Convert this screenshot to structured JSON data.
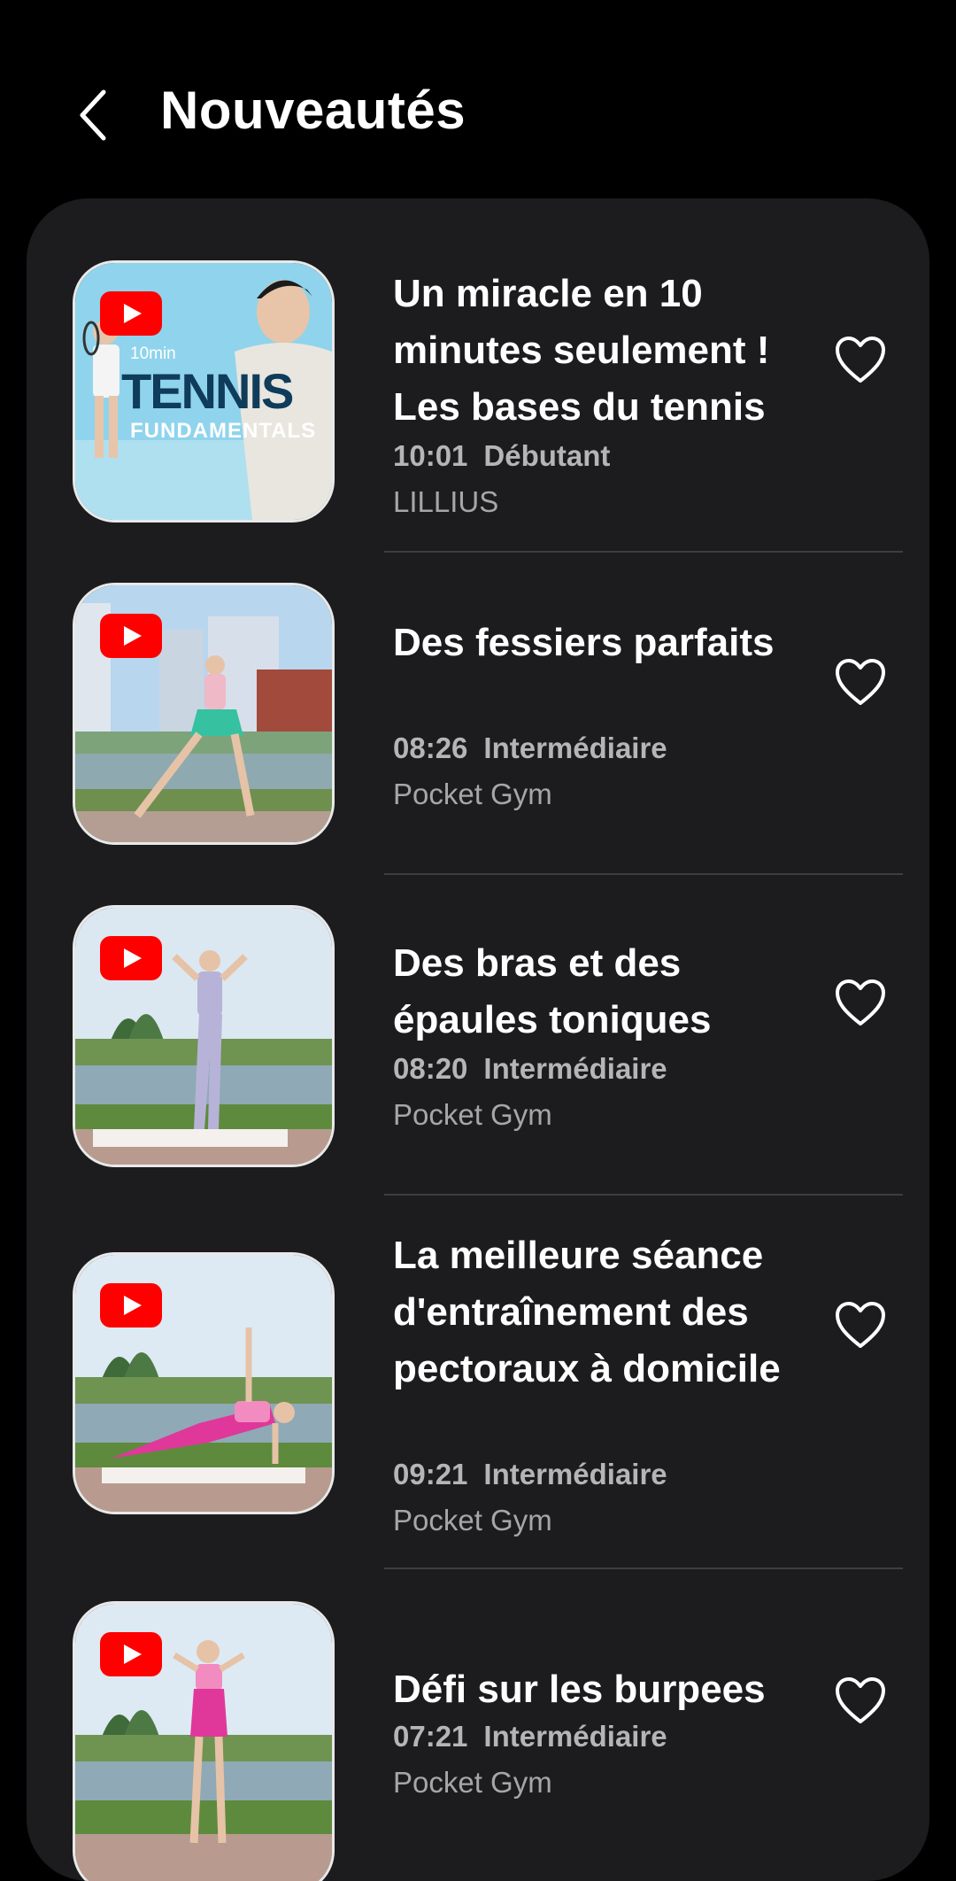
{
  "header": {
    "title": "Nouveautés",
    "back_icon": "chevron-left-icon"
  },
  "colors": {
    "background": "#000000",
    "card": "#1c1c1e",
    "youtube_red": "#ff0000"
  },
  "items": [
    {
      "title": "Un miracle en 10 minutes seulement ! Les bases du tennis",
      "duration": "10:01",
      "level": "Débutant",
      "author": "LILLIUS",
      "thumbnail_text": [
        "10min",
        "TENNIS",
        "FUNDAMENTALS"
      ],
      "favorite_icon": "heart-outline-icon"
    },
    {
      "title": "Des fessiers parfaits",
      "duration": "08:26",
      "level": "Intermédiaire",
      "author": "Pocket Gym",
      "favorite_icon": "heart-outline-icon"
    },
    {
      "title": "Des bras et des épaules toniques",
      "duration": "08:20",
      "level": "Intermédiaire",
      "author": "Pocket Gym",
      "favorite_icon": "heart-outline-icon"
    },
    {
      "title": "La meilleure séance d'entraînement des pectoraux à domicile",
      "duration": "09:21",
      "level": "Intermédiaire",
      "author": "Pocket Gym",
      "favorite_icon": "heart-outline-icon"
    },
    {
      "title": "Défi sur les burpees",
      "duration": "07:21",
      "level": "Intermédiaire",
      "author": "Pocket Gym",
      "favorite_icon": "heart-outline-icon"
    }
  ]
}
